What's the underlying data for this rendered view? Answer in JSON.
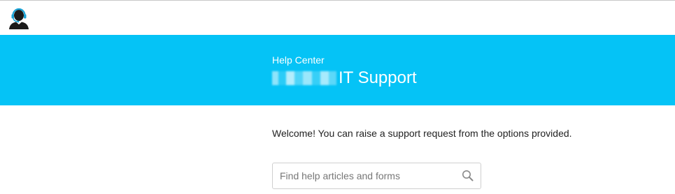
{
  "header": {
    "logo_icon": "support-agent-headset-icon"
  },
  "banner": {
    "background_color": "#05c3f6",
    "subtitle": "Help Center",
    "title_suffix": "IT Support"
  },
  "main": {
    "welcome_text": "Welcome! You can raise a support request from the options provided.",
    "search": {
      "placeholder": "Find help articles and forms",
      "value": "",
      "icon": "search-icon"
    }
  }
}
